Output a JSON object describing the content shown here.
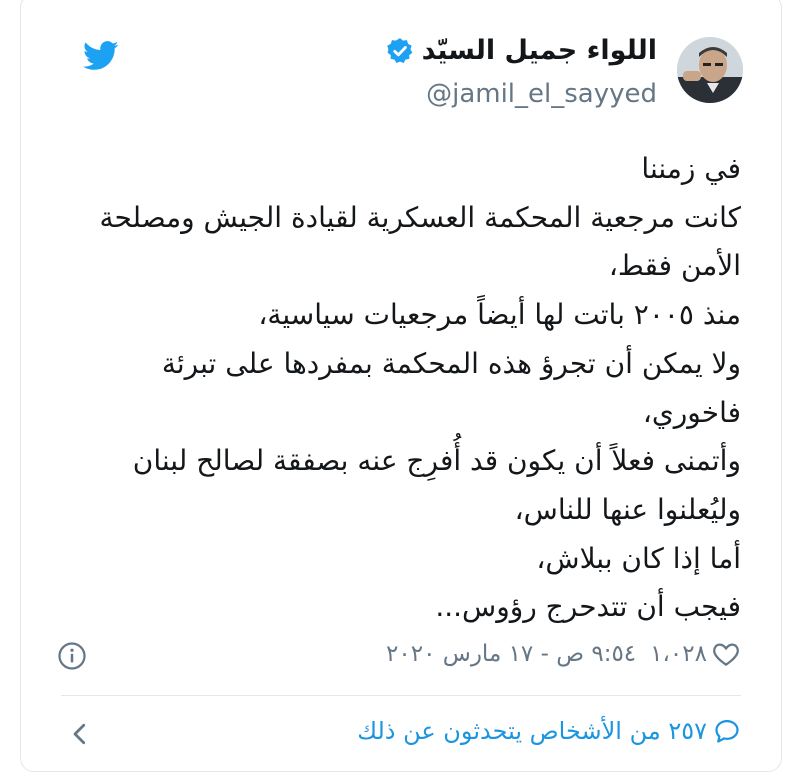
{
  "author": {
    "display_name": "اللواء جميل السيّد",
    "handle": "@jamil_el_sayyed",
    "verified": true
  },
  "tweet": {
    "lines": [
      "في زمننا",
      "كانت مرجعية المحكمة العسكرية لقيادة الجيش ومصلحة",
      "الأمن فقط،",
      "منذ ٢٠٠٥ باتت لها أيضاً مرجعيات سياسية،",
      "ولا يمكن أن تجرؤ هذه المحكمة بمفردها على تبرئة",
      "فاخوري،",
      "وأتمنى فعلاً أن يكون قد أُفرِج عنه بصفقة لصالح لبنان",
      "وليُعلنوا عنها للناس،",
      "أما إذا كان ببلاش،",
      "فيجب أن تتدحرج رؤوس..."
    ]
  },
  "meta": {
    "likes": "١،٠٢٨",
    "timestamp": "٩:٥٤ ص - ١٧ مارس ٢٠٢٠"
  },
  "footer": {
    "talking_label": "٢٥٧ من الأشخاص يتحدثون عن ذلك"
  },
  "colors": {
    "twitter_blue": "#1da1f2",
    "link_blue": "#1b95e0",
    "text": "#14171a",
    "secondary": "#657786",
    "border": "#e1e8ed"
  },
  "icons": {
    "logo": "twitter-bird-icon",
    "verified": "verified-badge-icon",
    "info": "info-icon",
    "like": "heart-icon",
    "reply": "speech-bubble-icon",
    "back": "chevron-left-icon"
  }
}
